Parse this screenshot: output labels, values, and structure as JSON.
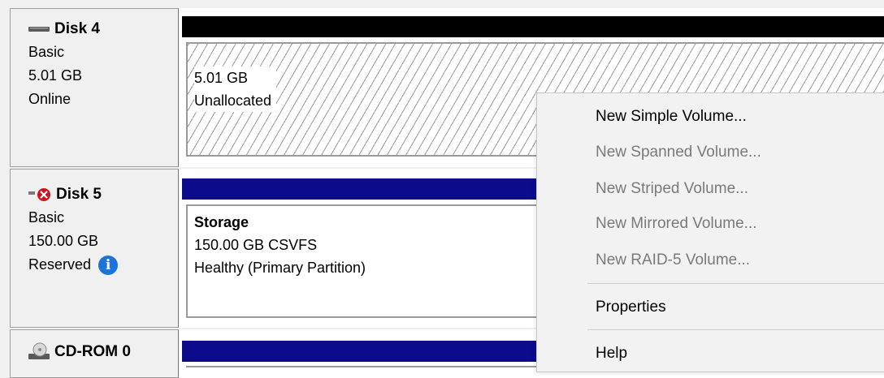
{
  "disks": [
    {
      "name": "Disk 4",
      "icon": "disk-icon",
      "type": "Basic",
      "size": "5.01 GB",
      "status": "Online",
      "partition": {
        "size": "5.01 GB",
        "label": "Unallocated"
      }
    },
    {
      "name": "Disk 5",
      "icon": "disk-offline-icon",
      "type": "Basic",
      "size": "150.00 GB",
      "status": "Reserved",
      "partition": {
        "name": "Storage",
        "size_fs": "150.00 GB CSVFS",
        "health": "Healthy (Primary Partition)"
      }
    },
    {
      "name": "CD-ROM 0",
      "icon": "cdrom-icon"
    }
  ],
  "context_menu": {
    "items": [
      {
        "label": "New Simple Volume...",
        "enabled": true
      },
      {
        "label": "New Spanned Volume...",
        "enabled": false
      },
      {
        "label": "New Striped Volume...",
        "enabled": false
      },
      {
        "label": "New Mirrored Volume...",
        "enabled": false
      },
      {
        "label": "New RAID-5 Volume...",
        "enabled": false
      },
      {
        "label": "Properties",
        "enabled": true
      },
      {
        "label": "Help",
        "enabled": true
      }
    ]
  },
  "colors": {
    "partition_bar_primary": "#0b0b8b",
    "partition_bar_unallocated": "#000000",
    "info_icon": "#1e73d8",
    "offline_icon": "#d0131f"
  }
}
